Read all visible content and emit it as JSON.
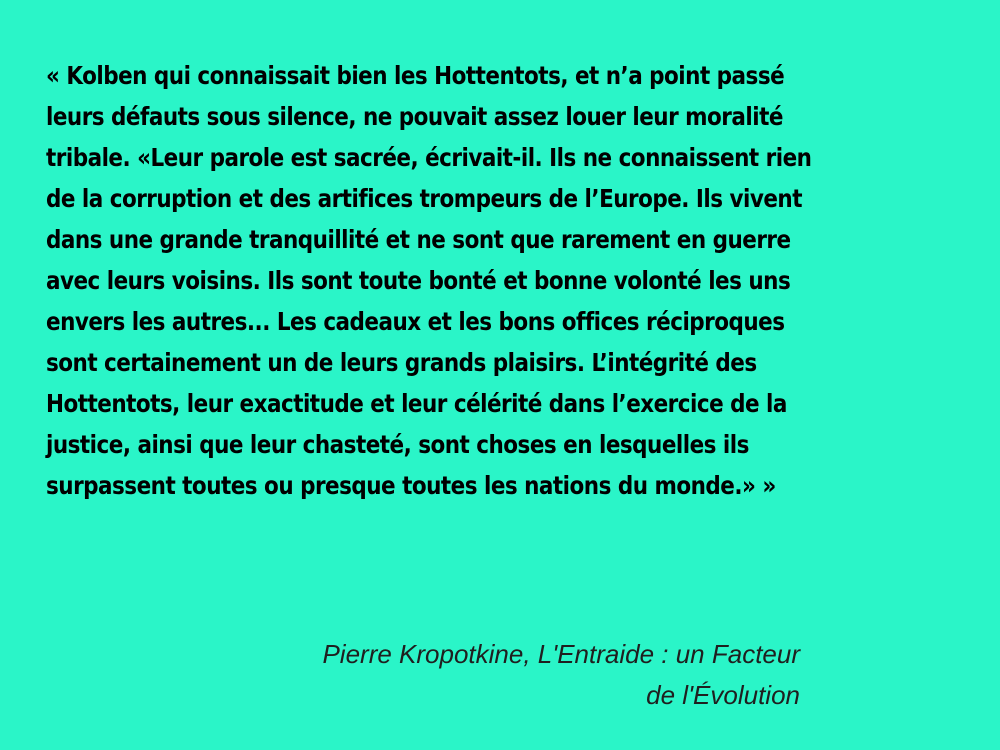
{
  "slide": {
    "background_color": "#2af5c8",
    "text_color": "#000000",
    "quote_lines": [
      "« Kolben qui connaissait bien les Hottentots, et n’a point passé",
      "leurs défauts sous silence, ne pouvait assez louer leur moralité",
      "tribale. «Leur parole est sacrée, écrivait-il. Ils ne connaissent rien",
      "de la corruption et des artifices trompeurs de l’Europe. Ils vivent",
      "dans une grande tranquillité et ne sont que rarement en guerre",
      "avec leurs voisins. Ils sont toute bonté et bonne volonté les uns",
      "envers les autres... Les cadeaux et les bons offices réciproques",
      "sont certainement un de leurs grands plaisirs. L’intégrité des",
      "Hottentots, leur exactitude et leur célérité dans l’exercice de la",
      "justice, ainsi que leur chasteté, sont choses en lesquelles ils",
      "surpassent toutes ou presque toutes les nations du monde.» »"
    ],
    "attribution_lines": [
      "Pierre Kropotkine, L'Entraide : un Facteur",
      "de l'Évolution"
    ]
  }
}
